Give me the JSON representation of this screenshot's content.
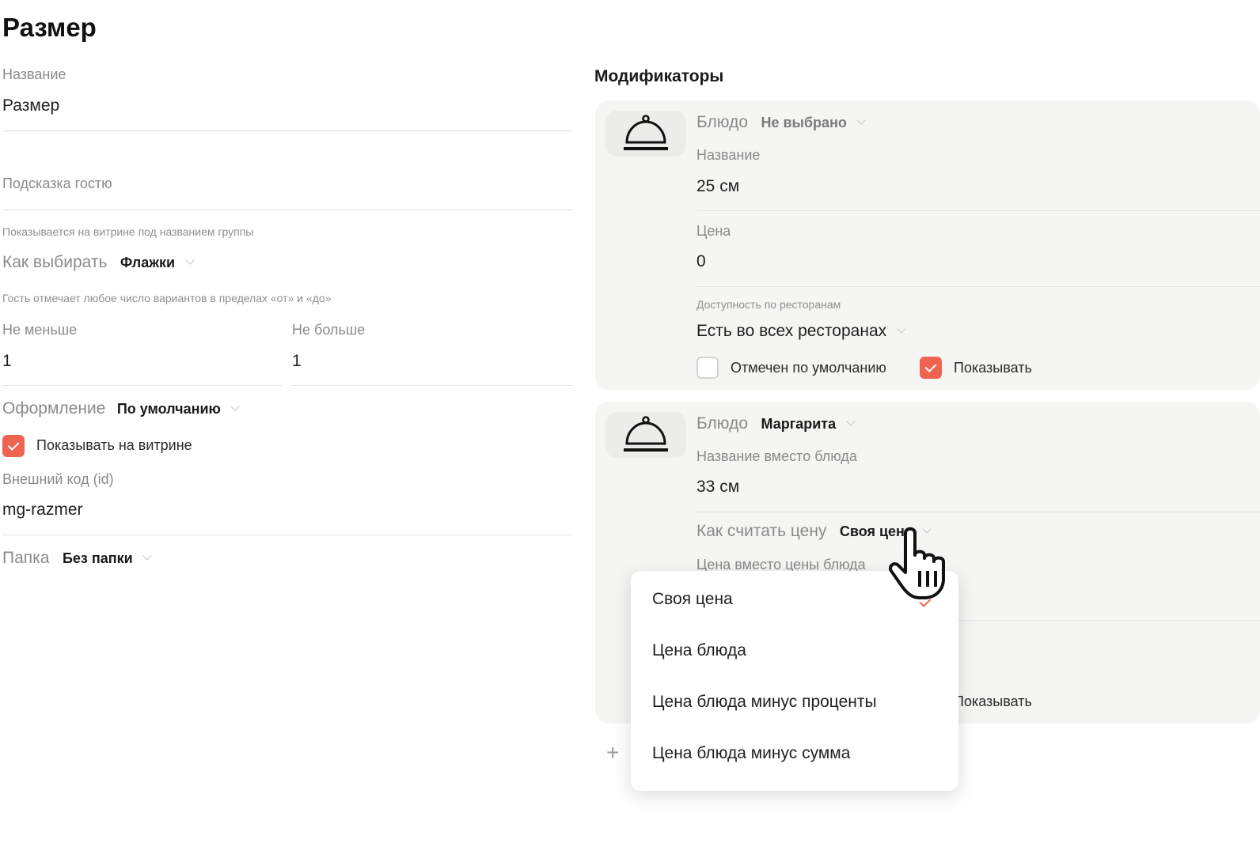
{
  "page": {
    "title": "Размер"
  },
  "left": {
    "name_label": "Название",
    "name_value": "Размер",
    "hint_label": "Подсказка гостю",
    "hint_note": "Показывается на витрине под названием группы",
    "choose_label": "Как выбирать",
    "choose_value": "Флажки",
    "choose_note": "Гость отмечает любое число вариантов в пределах «от» и «до»",
    "min_label": "Не меньше",
    "min_value": "1",
    "max_label": "Не больше",
    "max_value": "1",
    "style_label": "Оформление",
    "style_value": "По умолчанию",
    "show_label": "Показывать на витрине",
    "show_checked": true,
    "extcode_label": "Внешний код (id)",
    "extcode_value": "mg-razmer",
    "folder_label": "Папка",
    "folder_value": "Без папки"
  },
  "modifiers": {
    "title": "Модификаторы",
    "items": [
      {
        "dish_label": "Блюдо",
        "dish_value": "Не выбрано",
        "name_label": "Название",
        "name_value": "25 см",
        "price_label": "Цена",
        "price_value": "0",
        "avail_label": "Доступность по ресторанам",
        "avail_value": "Есть во всех ресторанах",
        "default_label": "Отмечен по умолчанию",
        "default_checked": false,
        "show_label": "Показывать",
        "show_checked": true
      },
      {
        "dish_label": "Блюдо",
        "dish_value": "Маргарита",
        "name_label": "Название вместо блюда",
        "name_value": "33 см",
        "pricing_label": "Как считать цену",
        "pricing_value": "Своя цена",
        "price_label": "Цена вместо цены блюда",
        "show_label": "Показывать"
      }
    ]
  },
  "dropdown": {
    "options": [
      "Своя цена",
      "Цена блюда",
      "Цена блюда минус проценты",
      "Цена блюда минус сумма"
    ],
    "selected": "Своя цена"
  },
  "colors": {
    "accent": "#ee6450",
    "card_bg": "#f5f5f4"
  },
  "icons": [
    "cloche-icon",
    "chevron-down-icon",
    "check-icon",
    "plus-icon",
    "hand-pointer-cursor"
  ]
}
